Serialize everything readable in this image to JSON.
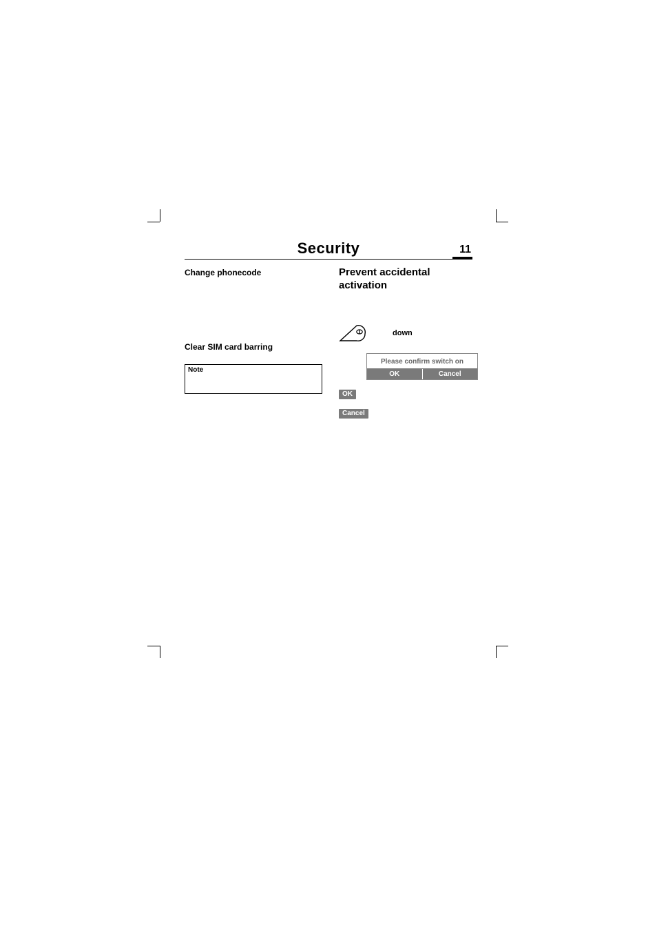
{
  "header": {
    "title": "Security",
    "page_number": "11"
  },
  "left_col": {
    "heading_change": "Change phonecode",
    "heading_clear": "Clear SIM card barring",
    "note_label": "Note"
  },
  "right_col": {
    "heading_prevent": "Prevent accidental activation",
    "hold_label": "down",
    "dialog_message": "Please confirm switch on",
    "dialog_ok": "OK",
    "dialog_cancel": "Cancel",
    "btn_ok": "OK",
    "btn_cancel": "Cancel"
  }
}
